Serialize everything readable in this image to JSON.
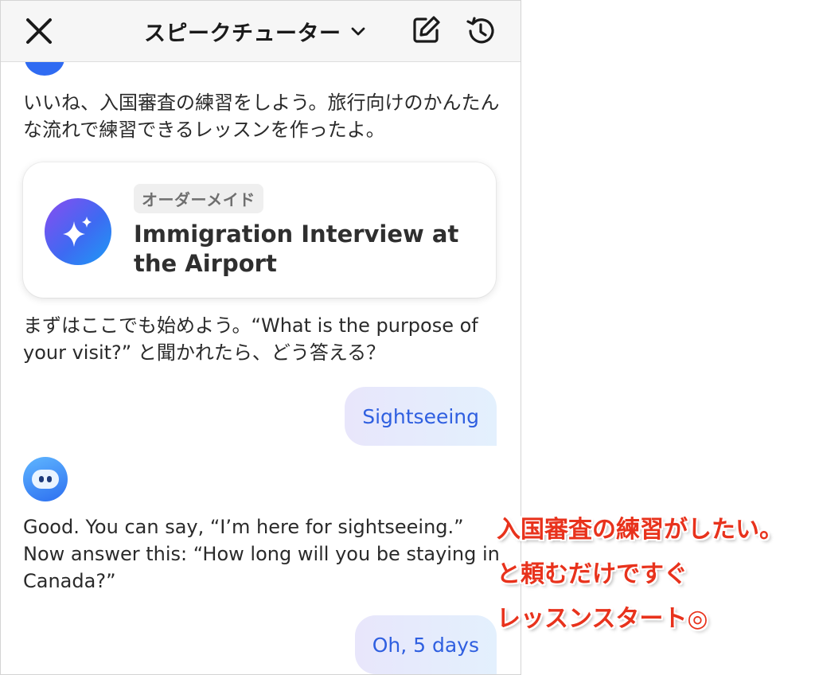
{
  "header": {
    "title": "スピークチューター",
    "icons": {
      "close": "close-icon",
      "dropdown": "chevron-down-icon",
      "edit": "edit-icon",
      "history": "history-icon"
    }
  },
  "chat": {
    "message1": "いいね、入国審査の練習をしよう。旅行向けのかんたんな流れで練習できるレッスンを作ったよ。",
    "lesson_card": {
      "tag": "オーダーメイド",
      "title": "Immigration Interview at the Airport",
      "icon": "sparkles-icon"
    },
    "message2": "まずはここでも始めよう。“What is the purpose of your visit?” と聞かれたら、どう答える？",
    "user_reply1": "Sightseeing",
    "message3": "Good. You can say, “I’m here for sightseeing.” Now answer this: “How long will you be staying in Canada?”",
    "user_reply2": "Oh, 5 days"
  },
  "annotation": {
    "line1": "入国審査の練習がしたい。",
    "line2": "と頼むだけですぐ",
    "line3": "レッスンスタート◎"
  },
  "colors": {
    "accent": "#2f5fe0",
    "annotation": "#e8321c",
    "header_bg": "#f6f6f6"
  }
}
